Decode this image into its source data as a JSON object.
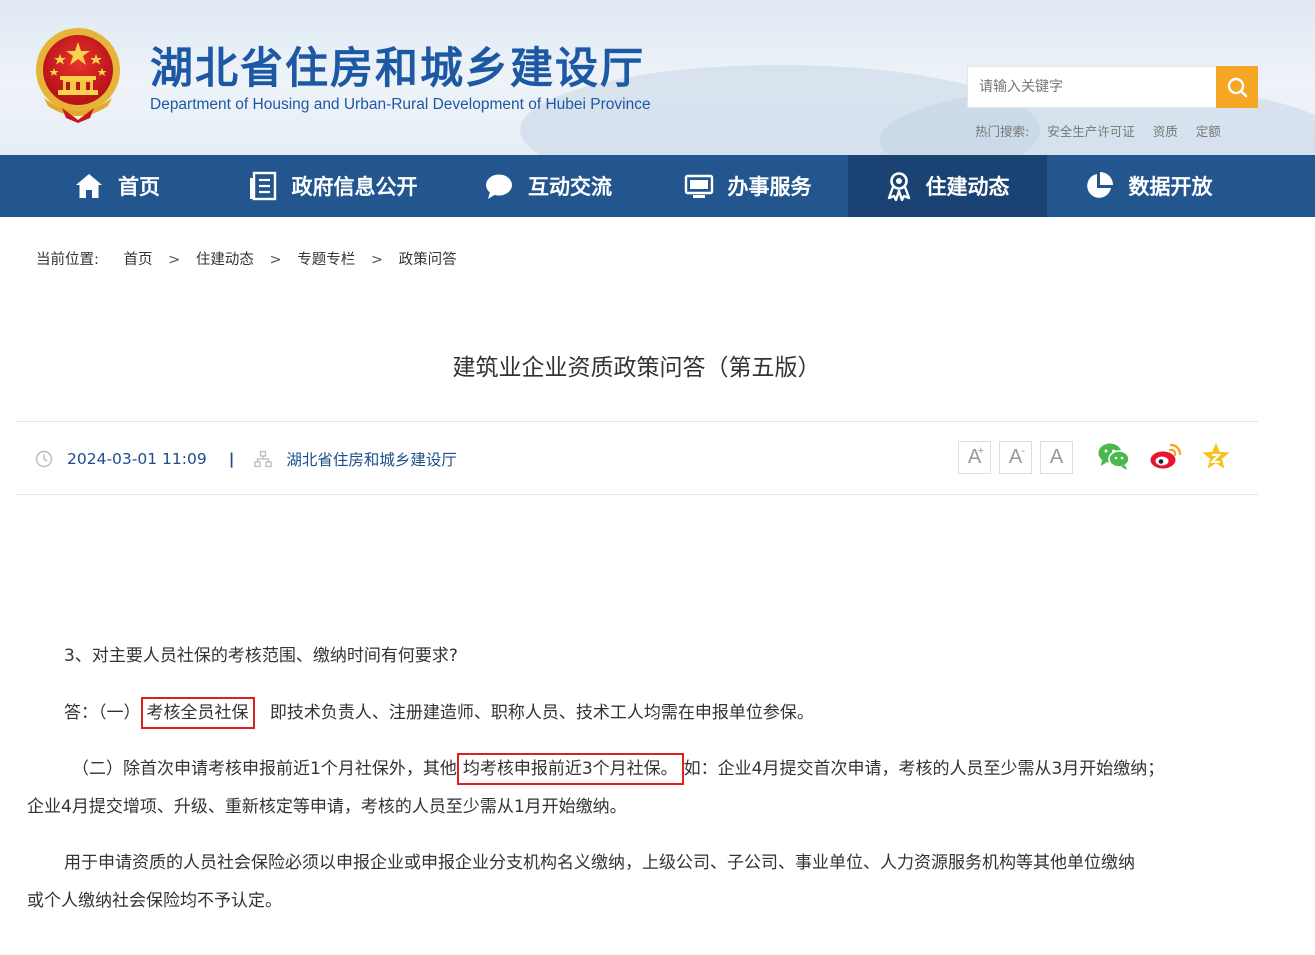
{
  "header": {
    "title": "湖北省住房和城乡建设厅",
    "subtitle": "Department of Housing and Urban-Rural Development of Hubei Province",
    "search_placeholder": "请输入关键字",
    "hot_search_label": "热门搜索:",
    "hot_search_items": [
      "安全生产许可证",
      "资质",
      "定额"
    ]
  },
  "nav": {
    "items": [
      {
        "label": "首页",
        "icon": "home-icon"
      },
      {
        "label": "政府信息公开",
        "icon": "document-list-icon"
      },
      {
        "label": "互动交流",
        "icon": "chat-bubble-icon"
      },
      {
        "label": "办事服务",
        "icon": "monitor-icon"
      },
      {
        "label": "住建动态",
        "icon": "award-icon",
        "active": true
      },
      {
        "label": "数据开放",
        "icon": "pie-chart-icon"
      }
    ],
    "active_color": "#1a4272",
    "bar_color": "#23568f"
  },
  "breadcrumb": {
    "label": "当前位置:",
    "separator": ">",
    "items": [
      "首页",
      "住建动态",
      "专题专栏",
      "政策问答"
    ]
  },
  "article": {
    "title": "建筑业企业资质政策问答（第五版）",
    "date": "2024-03-01 11:09",
    "divider": "|",
    "source": "湖北省住房和城乡建设厅",
    "font_sizes": {
      "large": "A",
      "small": "A",
      "default": "A"
    },
    "font_size_marks": {
      "plus": "+",
      "minus": "-"
    },
    "share_icons": [
      "wechat-icon",
      "weibo-icon",
      "favorite-star-icon"
    ],
    "question": "3、对主要人员社保的考核范围、缴纳时间有何要求?",
    "answer1_prefix": "答：（一）",
    "answer1_highlight": "考核全员社保",
    "answer1_rest": "即技术负责人、注册建造师、职称人员、技术工人均需在申报单位参保。",
    "answer2_prefix": "（二）除首次申请考核申报前近1个月社保外，其他",
    "answer2_highlight": "均考核申报前近3个月社保。",
    "answer2_rest": "如：企业4月提交首次申请，考核的人员至少需从3月开始缴纳；",
    "answer2_line2": "企业4月提交增项、升级、重新核定等申请，考核的人员至少需从1月开始缴纳。",
    "para3_line1": "用于申请资质的人员社会保险必须以申报企业或申报企业分支机构名义缴纳，上级公司、子公司、事业单位、人力资源服务机构等其他单位缴纳",
    "para3_line2": "或个人缴纳社会保险均不予认定。"
  },
  "colors": {
    "brand_blue": "#1c58a4",
    "search_button": "#f5a623",
    "highlight_border": "#e02020"
  }
}
